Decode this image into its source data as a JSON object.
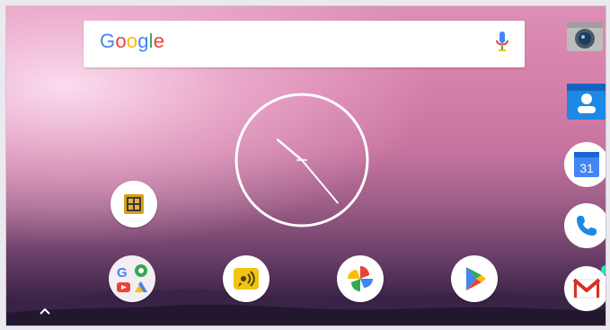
{
  "search": {
    "logo_letters": [
      "G",
      "o",
      "o",
      "g",
      "l",
      "e"
    ],
    "mic_icon": "microphone-icon"
  },
  "clock": {
    "hour_hand_deg": -50,
    "minute_hand_deg": 140
  },
  "home": {
    "apps": [
      {
        "name": "app-icon-yellow-grid",
        "icon": "grid-app-icon"
      }
    ],
    "dock": [
      {
        "name": "google-apps-folder",
        "icon": "google-folder-icon"
      },
      {
        "name": "audio-app",
        "icon": "sound-wave-icon"
      },
      {
        "name": "google-photos",
        "icon": "pinwheel-icon"
      },
      {
        "name": "play-store",
        "icon": "play-store-icon"
      }
    ]
  },
  "sidebar": {
    "items": [
      {
        "name": "camera",
        "icon": "camera-icon"
      },
      {
        "name": "contacts",
        "icon": "contacts-icon"
      },
      {
        "name": "calendar",
        "icon": "calendar-icon",
        "label": "31"
      },
      {
        "name": "phone",
        "icon": "phone-icon"
      },
      {
        "name": "gmail",
        "icon": "gmail-icon",
        "has_badge": true
      }
    ]
  },
  "colors": {
    "google_blue": "#4285f4",
    "google_red": "#ea4335",
    "google_yellow": "#fbbc05",
    "google_green": "#34a853",
    "notification_badge": "#1de9b6"
  }
}
